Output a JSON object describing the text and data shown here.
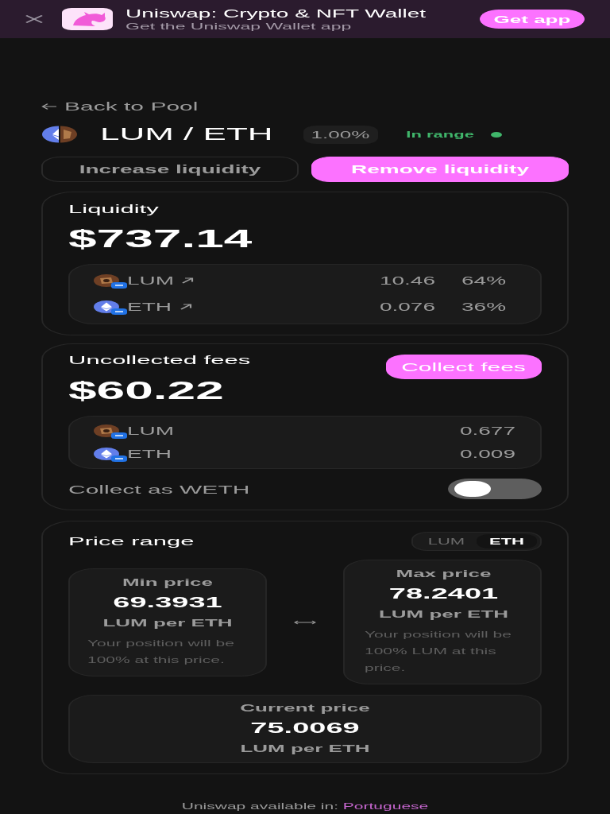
{
  "banner": {
    "title": "Uniswap: Crypto & NFT Wallet",
    "subtitle": "Get the Uniswap Wallet app",
    "button": "Get app"
  },
  "back_link": "Back to Pool",
  "pair": {
    "title": "LUM / ETH",
    "fee": "1.00%",
    "status": "In range",
    "in_range": true
  },
  "actions": [
    {
      "label": "Increase liquidity",
      "kind": "outline"
    },
    {
      "label": "Remove liquidity",
      "kind": "filled"
    }
  ],
  "liquidity": {
    "title": "Liquidity",
    "value": "$737.14",
    "tokens": [
      {
        "kind": "lum",
        "symbol": "LUM",
        "linked": true,
        "amount": "10.46",
        "share": "64%"
      },
      {
        "kind": "eth",
        "symbol": "ETH",
        "linked": true,
        "amount": "0.076",
        "share": "36%"
      }
    ]
  },
  "fees": {
    "title": "Uncollected fees",
    "button": "Collect fees",
    "value": "$60.22",
    "tokens": [
      {
        "kind": "lum",
        "symbol": "LUM",
        "amount": "0.677"
      },
      {
        "kind": "eth",
        "symbol": "ETH",
        "amount": "0.009"
      }
    ],
    "weth_toggle": {
      "label": "Collect as WETH",
      "on": false
    }
  },
  "price_range": {
    "title": "Price range",
    "units": [
      {
        "label": "LUM",
        "selected": false
      },
      {
        "label": "ETH",
        "selected": true
      }
    ],
    "min": {
      "label": "Min price",
      "value": "69.3931",
      "unit": "LUM per ETH",
      "note": "Your position will be 100% at this price."
    },
    "max": {
      "label": "Max price",
      "value": "78.2401",
      "unit": "LUM per ETH",
      "note": "Your position will be 100% LUM at this price."
    },
    "current": {
      "label": "Current price",
      "value": "75.0069",
      "unit": "LUM per ETH"
    }
  },
  "footer": {
    "text": "Uniswap available in:",
    "link": "Portuguese"
  }
}
